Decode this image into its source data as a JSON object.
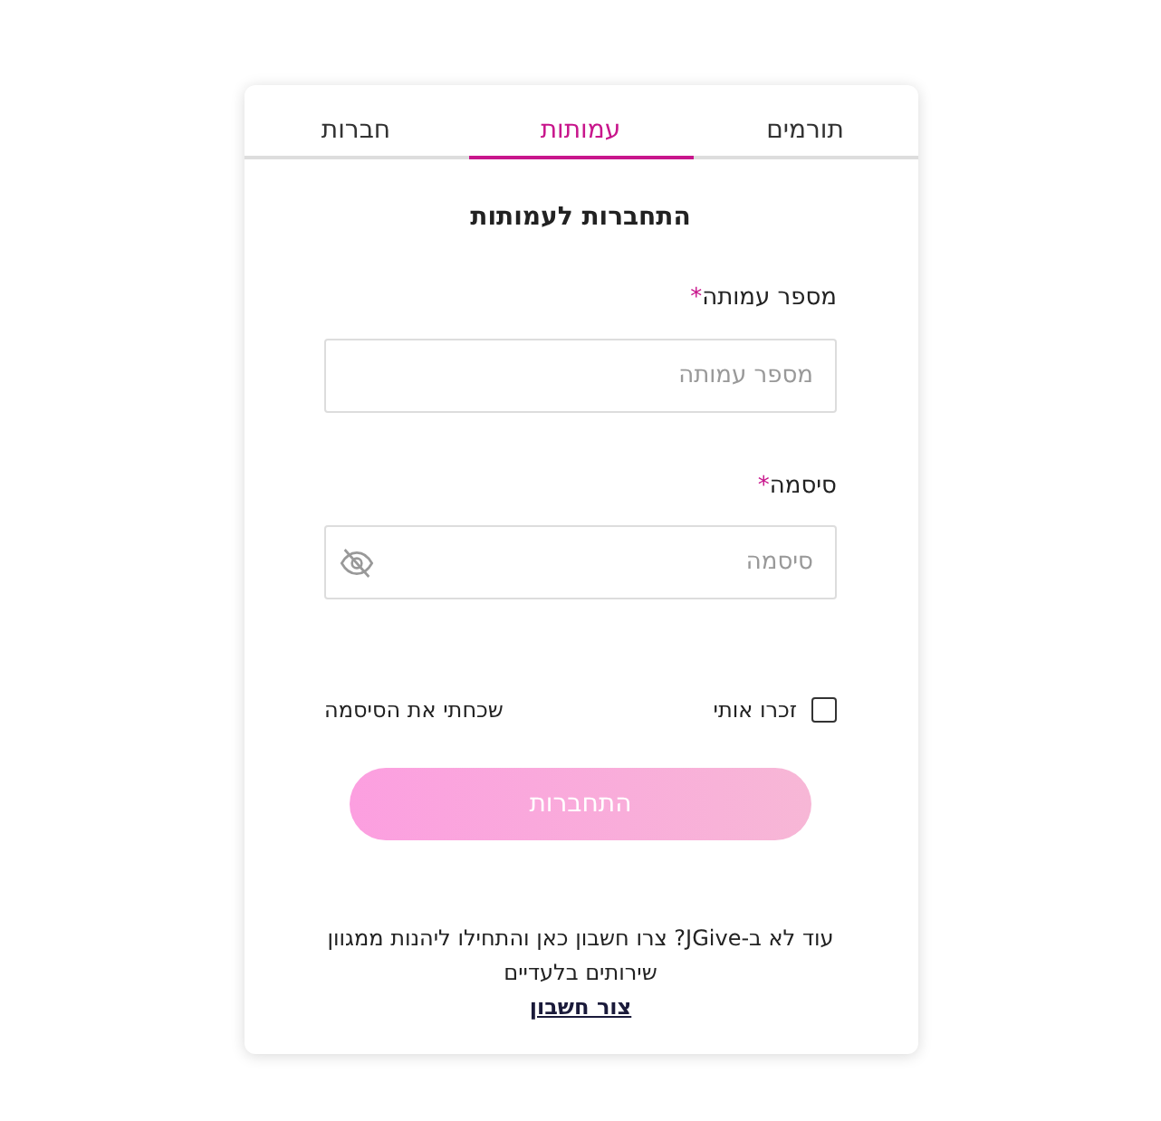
{
  "tabs": [
    {
      "label": "תורמים",
      "selected": false
    },
    {
      "label": "עמותות",
      "selected": true
    },
    {
      "label": "חברות",
      "selected": false
    }
  ],
  "heading": "התחברות לעמותות",
  "fields": [
    {
      "label": "מספר עמותה",
      "required_mark": "*",
      "placeholder": "מספר עמותה",
      "kind": "text"
    },
    {
      "label": "סיסמה",
      "required_mark": "*",
      "placeholder": "סיסמה",
      "kind": "password"
    }
  ],
  "remember": {
    "label": "זכרו אותי",
    "checked": false
  },
  "forgot_link": "שכחתי את הסיסמה",
  "submit": {
    "label": "התחברות",
    "disabled": true
  },
  "signup_text": "עוד לא ב-JGive? צרו חשבון כאן והתחילו ליהנות ממגוון שירותים בלעדיים",
  "signup_link": "צור חשבון"
}
